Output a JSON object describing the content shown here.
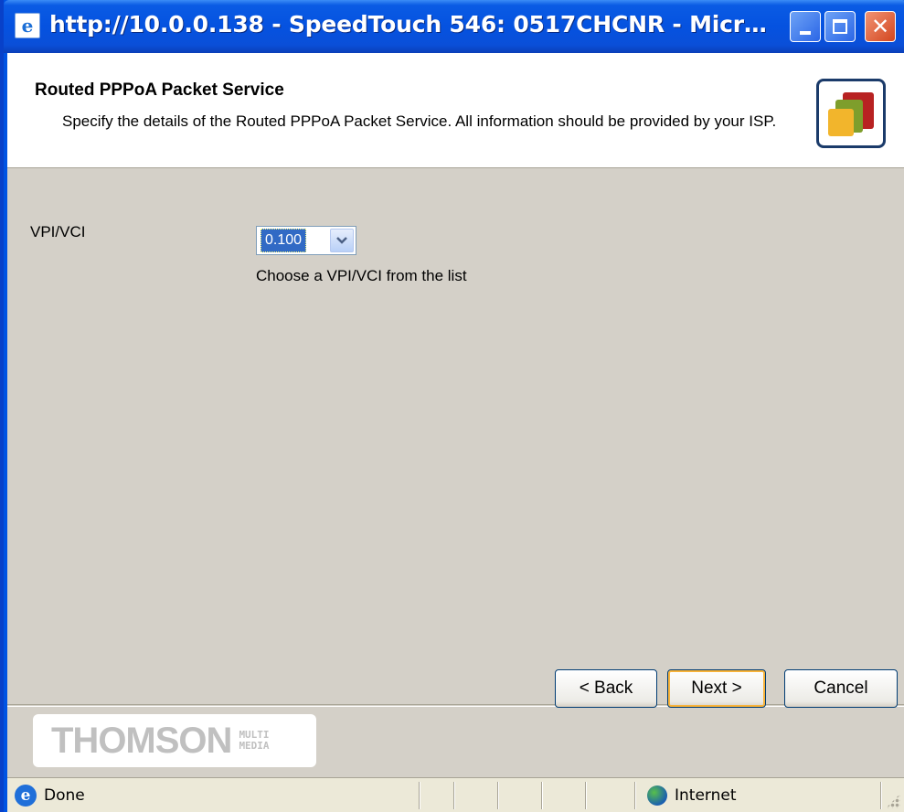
{
  "window": {
    "title": "http://10.0.0.138 - SpeedTouch 546:  0517CHCNR - Microsof...",
    "title_icon": "ie-page-icon"
  },
  "header": {
    "title": "Routed PPPoA Packet Service",
    "description": "Specify the details of the Routed PPPoA Packet Service. All information should be provided by your ISP.",
    "logo_icon": "speedtouch-squares-icon"
  },
  "form": {
    "vpi_vci_label": "VPI/VCI",
    "vpi_vci_selected": "0.100",
    "vpi_vci_hint": "Choose a VPI/VCI from the list"
  },
  "footer": {
    "brand": "THOMSON",
    "brand_sub_line1": "MULTI",
    "brand_sub_line2": "MEDIA",
    "back_label": "< Back",
    "next_label": "Next >",
    "cancel_label": "Cancel"
  },
  "status": {
    "text": "Done",
    "zone": "Internet"
  },
  "colors": {
    "titlebar": "#0a5be4",
    "content_bg": "#d4d0c8",
    "selection": "#316ac5",
    "close_button": "#d3461f"
  }
}
